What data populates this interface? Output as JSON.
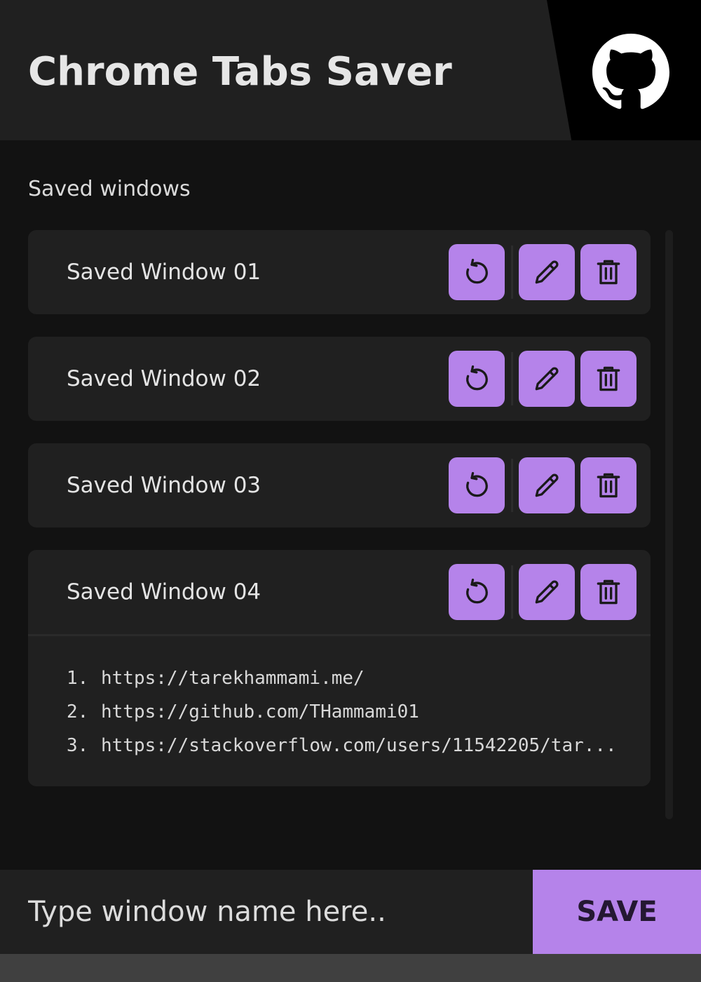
{
  "header": {
    "title": "Chrome Tabs Saver",
    "github_icon": "github-icon"
  },
  "section": {
    "title": "Saved windows"
  },
  "windows": [
    {
      "name": "Saved Window 01"
    },
    {
      "name": "Saved Window 02"
    },
    {
      "name": "Saved Window 03"
    },
    {
      "name": "Saved Window 04",
      "expanded": true,
      "links": [
        {
          "num": "1.",
          "url": "https://tarekhammami.me/"
        },
        {
          "num": "2.",
          "url": "https://github.com/THammami01"
        },
        {
          "num": "3.",
          "url": "https://stackoverflow.com/users/11542205/tar..."
        }
      ]
    }
  ],
  "actions": {
    "restore_icon": "restore-icon",
    "edit_icon": "pencil-icon",
    "delete_icon": "trash-icon"
  },
  "input": {
    "placeholder": "Type window name here..",
    "value": ""
  },
  "save_button": {
    "label": "SAVE"
  },
  "colors": {
    "accent": "#b583ea",
    "background": "#121212",
    "surface": "#202020"
  }
}
